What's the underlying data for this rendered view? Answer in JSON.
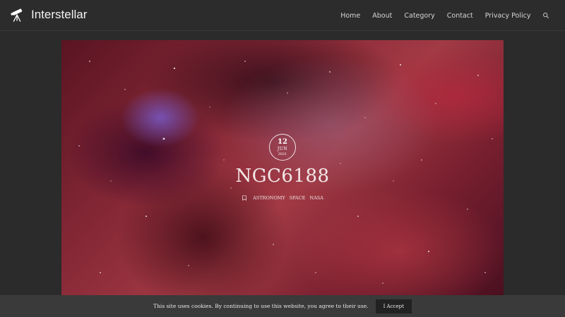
{
  "header": {
    "brand": "Interstellar",
    "nav": [
      "Home",
      "About",
      "Category",
      "Contact",
      "Privacy Policy"
    ]
  },
  "post": {
    "date": {
      "day": "12",
      "month": "JUN",
      "year": "2021"
    },
    "title": "NGC6188",
    "tags": [
      "ASTRONOMY",
      "SPACE",
      "NASA"
    ]
  },
  "cookie": {
    "message": "This site uses cookies. By continuing to use this website, you agree to their use.",
    "accept_label": "I Accept"
  },
  "colors": {
    "background": "#2b2b2b",
    "cookie_bar": "#3a3a3a",
    "accept_button": "#222222"
  },
  "icons": {
    "brand": "telescope-icon",
    "search": "search-icon",
    "tag": "tag-icon"
  }
}
